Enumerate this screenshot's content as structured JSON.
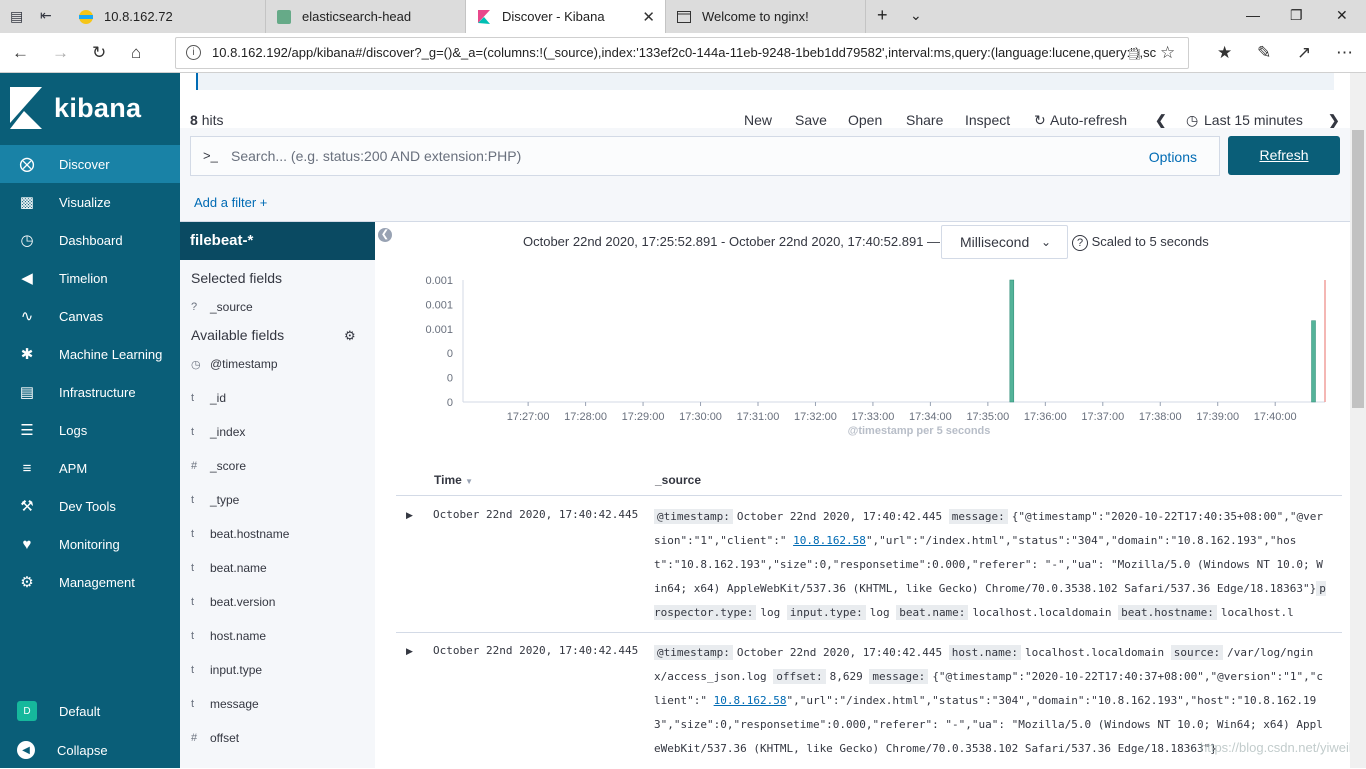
{
  "browser": {
    "tabs": [
      {
        "label": "10.8.162.72"
      },
      {
        "label": "elasticsearch-head"
      },
      {
        "label": "Discover - Kibana"
      },
      {
        "label": "Welcome to nginx!"
      }
    ],
    "url": "10.8.162.192/app/kibana#/discover?_g=()&_a=(columns:!(_source),index:'133ef2c0-144a-11eb-9248-1beb1dd79582',interval:ms,query:(language:lucene,query:''),sc"
  },
  "sidebar": {
    "brand": "kibana",
    "items": [
      {
        "label": "Discover",
        "icon": "compass-icon"
      },
      {
        "label": "Visualize",
        "icon": "bar-chart-icon"
      },
      {
        "label": "Dashboard",
        "icon": "dashboard-icon"
      },
      {
        "label": "Timelion",
        "icon": "timelion-icon"
      },
      {
        "label": "Canvas",
        "icon": "canvas-icon"
      },
      {
        "label": "Machine Learning",
        "icon": "ml-icon"
      },
      {
        "label": "Infrastructure",
        "icon": "infrastructure-icon"
      },
      {
        "label": "Logs",
        "icon": "logs-icon"
      },
      {
        "label": "APM",
        "icon": "apm-icon"
      },
      {
        "label": "Dev Tools",
        "icon": "wrench-icon"
      },
      {
        "label": "Monitoring",
        "icon": "heartbeat-icon"
      },
      {
        "label": "Management",
        "icon": "gear-icon"
      }
    ],
    "space_badge": "D",
    "space_label": "Default",
    "collapse_label": "Collapse"
  },
  "toolbar": {
    "hits_count": "8",
    "hits_label": "hits",
    "menu": [
      "New",
      "Save",
      "Open",
      "Share",
      "Inspect",
      "Auto-refresh"
    ],
    "time_label": "Last 15 minutes"
  },
  "query": {
    "prompt": ">_",
    "placeholder": "Search... (e.g. status:200 AND extension:PHP)",
    "options_label": "Options",
    "refresh_label": "Refresh"
  },
  "filters": {
    "add_label": "Add a filter +"
  },
  "fields": {
    "index_pattern": "filebeat-*",
    "selected_title": "Selected fields",
    "selected": [
      {
        "type": "?",
        "name": "_source"
      }
    ],
    "available_title": "Available fields",
    "available": [
      {
        "type": "clock",
        "name": "@timestamp"
      },
      {
        "type": "t",
        "name": "_id"
      },
      {
        "type": "t",
        "name": "_index"
      },
      {
        "type": "#",
        "name": "_score"
      },
      {
        "type": "t",
        "name": "_type"
      },
      {
        "type": "t",
        "name": "beat.hostname"
      },
      {
        "type": "t",
        "name": "beat.name"
      },
      {
        "type": "t",
        "name": "beat.version"
      },
      {
        "type": "t",
        "name": "host.name"
      },
      {
        "type": "t",
        "name": "input.type"
      },
      {
        "type": "t",
        "name": "message"
      },
      {
        "type": "#",
        "name": "offset"
      }
    ]
  },
  "histogram": {
    "range_text": "October 22nd 2020, 17:25:52.891 - October 22nd 2020, 17:40:52.891 —",
    "interval": "Millisecond",
    "scaled_text": "Scaled to 5 seconds"
  },
  "chart_data": {
    "type": "bar",
    "xlabel": "@timestamp per 5 seconds",
    "ylabel": "",
    "x_ticks": [
      "17:27:00",
      "17:28:00",
      "17:29:00",
      "17:30:00",
      "17:31:00",
      "17:32:00",
      "17:33:00",
      "17:34:00",
      "17:35:00",
      "17:36:00",
      "17:37:00",
      "17:38:00",
      "17:39:00",
      "17:40:00"
    ],
    "y_ticks": [
      "0",
      "0",
      "0",
      "0.001",
      "0.001",
      "0.001"
    ],
    "series": [
      {
        "values": [
          {
            "x": "17:35:25",
            "y": 0.0012
          },
          {
            "x": "17:40:40",
            "y": 0.0008
          }
        ]
      }
    ],
    "bar_color": "#54b399"
  },
  "table": {
    "col_time": "Time",
    "col_source": "_source",
    "rows": [
      {
        "time": "October 22nd 2020, 17:40:42.445",
        "parts": [
          {
            "k": "@timestamp:",
            "v": "October 22nd 2020, 17:40:42.445"
          },
          {
            "k": "message:",
            "v": "{\"@timestamp\":\"2020-10-22T17:40:35+08:00\",\"@version\":\"1\",\"client\":\""
          },
          {
            "link": "10.8.162.58"
          },
          {
            "v": "\",\"url\":\"/index.html\",\"status\":\"304\",\"domain\":\"10.8.162.193\",\"host\":\"10.8.162.193\",\"size\":0,\"responsetime\":0.000,\"referer\": \"-\",\"ua\": \"Mozilla/5.0 (Windows NT 10.0; Win64; x64) AppleWebKit/537.36 (KHTML, like Gecko) Chrome/70.0.3538.102 Safari/537.36 Edge/18.18363\"}"
          },
          {
            "k": "prospector.type:",
            "v": "log"
          },
          {
            "k": "input.type:",
            "v": "log"
          },
          {
            "k": "beat.name:",
            "v": "localhost.localdomain"
          },
          {
            "k": "beat.hostname:",
            "v": "localhost.l"
          }
        ]
      },
      {
        "time": "October 22nd 2020, 17:40:42.445",
        "parts": [
          {
            "k": "@timestamp:",
            "v": "October 22nd 2020, 17:40:42.445"
          },
          {
            "k": "host.name:",
            "v": "localhost.localdomain"
          },
          {
            "k": "source:",
            "v": "/var/log/nginx/access_json.log"
          },
          {
            "k": "offset:",
            "v": "8,629"
          },
          {
            "k": "message:",
            "v": "{\"@timestamp\":\"2020-10-22T17:40:37+08:00\",\"@version\":\"1\",\"client\":\""
          },
          {
            "link": "10.8.162.58"
          },
          {
            "v": "\",\"url\":\"/index.html\",\"status\":\"304\",\"domain\":\"10.8.162.193\",\"host\":\"10.8.162.193\",\"size\":0,\"responsetime\":0.000,\"referer\": \"-\",\"ua\": \"Mozilla/5.0 (Windows NT 10.0; Win64; x64) AppleWebKit/537.36 (KHTML, like Gecko) Chrome/70.0.3538.102 Safari/537.36 Edge/18.18363\"}"
          }
        ]
      }
    ]
  },
  "watermark": "https://blog.csdn.net/yiweili"
}
